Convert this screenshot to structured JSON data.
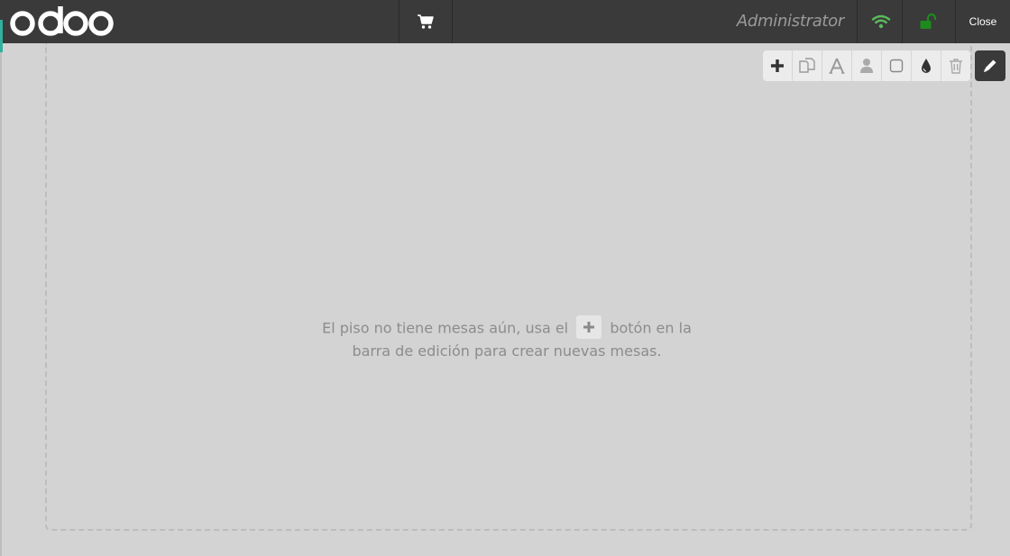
{
  "header": {
    "logo_text": "odoo",
    "cart_icon": "shopping-cart-icon",
    "username": "Administrator",
    "wifi_icon": "wifi-icon",
    "lock_icon": "unlock-icon",
    "close_label": "Close",
    "colors": {
      "bar": "#3a3a3a",
      "status_ok": "#5cb85c",
      "lock": "#1e8a1e"
    }
  },
  "toolbar": {
    "tools": [
      {
        "icon": "plus-icon",
        "name": "add-table"
      },
      {
        "icon": "duplicate-icon",
        "name": "duplicate-table"
      },
      {
        "icon": "rename-icon",
        "name": "rename-table"
      },
      {
        "icon": "seats-icon",
        "name": "table-seats"
      },
      {
        "icon": "shape-icon",
        "name": "table-shape"
      },
      {
        "icon": "color-drop-icon",
        "name": "table-color"
      },
      {
        "icon": "trash-icon",
        "name": "delete-table"
      }
    ],
    "edit_icon": "pencil-icon"
  },
  "floor": {
    "empty_before": "El piso no tiene mesas aún, usa el",
    "empty_after": "botón en la",
    "empty_line2": "barra de edición para crear nuevas mesas.",
    "background": "#d3d3d3"
  }
}
